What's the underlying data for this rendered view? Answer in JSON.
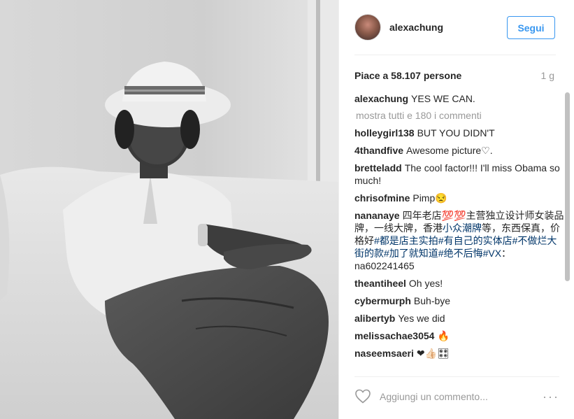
{
  "post": {
    "username": "alexachung",
    "follow_label": "Segui",
    "likes": "Piace a 58.107 persone",
    "age": "1 g",
    "caption_user": "alexachung",
    "caption_text": "YES WE CAN.",
    "load_more": "mostra tutti e 180 i commenti",
    "add_comment_placeholder": "Aggiungi un commento...",
    "more_dots": "···"
  },
  "comments": [
    {
      "user": "holleygirl138",
      "text": "BUT YOU DIDN'T"
    },
    {
      "user": "4thandfive",
      "text": "Awesome picture♡."
    },
    {
      "user": "bretteladd",
      "text": "The cool factor!!! I'll miss Obama so much!"
    },
    {
      "user": "chrisofmine",
      "text": "Pimp",
      "emoji": "😒"
    },
    {
      "user": "nananaye",
      "text_a": "四年老店",
      "emoji": "💯💯",
      "text_b": "主营独立设计师女装品牌，一线大牌，香港",
      "hashtag1": "小众潮牌",
      "text_c": "等，东西保真，价格好",
      "hashtag2": "#都是店主实拍#有自己的实体店#不做烂大街的款#加了就知道#绝不后悔#VX",
      "text_d": "：na602241465"
    },
    {
      "user": "theantiheel",
      "text": "Oh yes!"
    },
    {
      "user": "cybermurph",
      "text": "Buh-bye"
    },
    {
      "user": "alibertyb",
      "text": "Yes we did"
    },
    {
      "user": "melissachae3054",
      "emoji": "🔥"
    },
    {
      "user": "naseemsaeri",
      "emoji": "❤👍🏻🎛"
    }
  ],
  "colors": {
    "accent": "#3897f0",
    "hashtag": "#003569",
    "muted": "#999999"
  },
  "icons": {
    "like": "heart-outline-icon",
    "options": "more-options-icon"
  }
}
